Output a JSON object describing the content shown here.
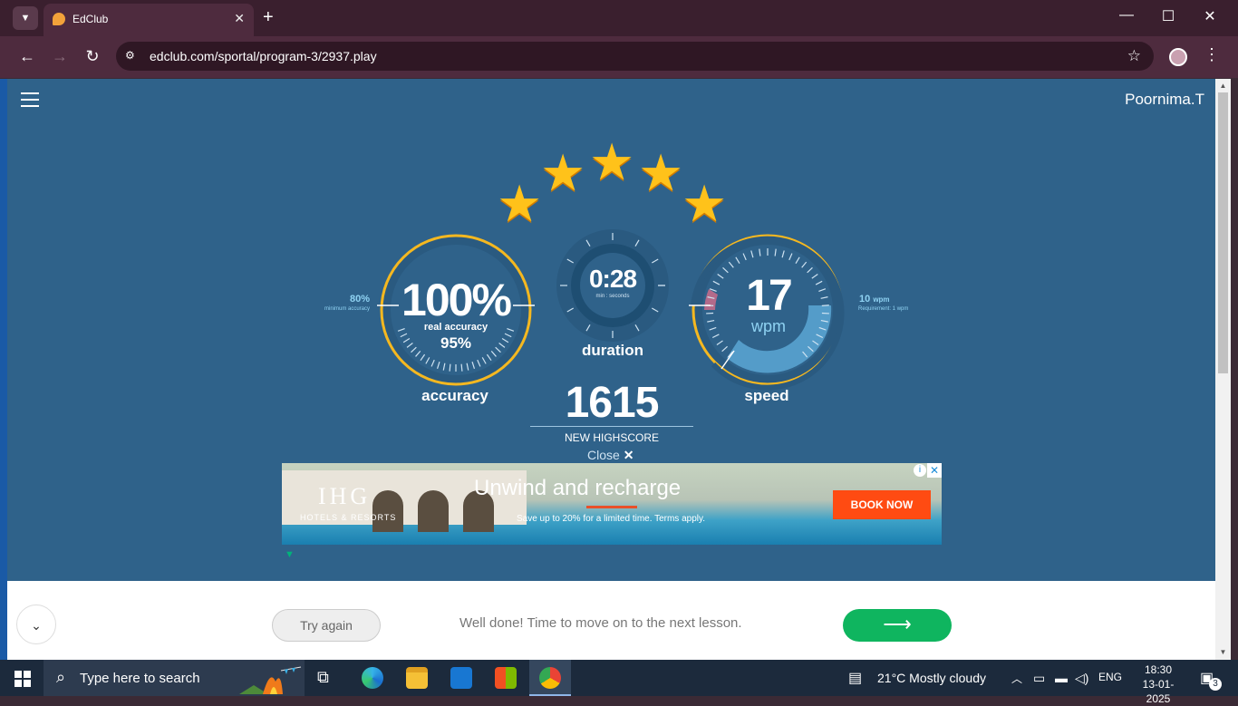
{
  "browser": {
    "tab_title": "EdClub",
    "url": "edclub.com/sportal/program-3/2937.play",
    "tab_close": "✕",
    "new_tab": "+"
  },
  "page": {
    "user_name": "Poornima.T",
    "accuracy": {
      "value": "100%",
      "real_label": "real accuracy",
      "real_value": "95%",
      "label": "accuracy",
      "min_value": "80%",
      "min_label": "minimum accuracy"
    },
    "duration": {
      "value": "0:28",
      "unit": "min : seconds",
      "label": "duration"
    },
    "speed": {
      "value": "17",
      "unit": "wpm",
      "label": "speed",
      "req_value": "10",
      "req_unit": "wpm",
      "req_label": "Requirement: 1 wpm"
    },
    "score": {
      "value": "1615",
      "label": "NEW HIGHSCORE"
    },
    "close_label": "Close",
    "stars_earned": 5
  },
  "ad": {
    "logo": "IHG",
    "logo_sub": "HOTELS & RESORTS",
    "headline": "Unwind and recharge",
    "body": "Save up to 20% for a limited time. Terms apply.",
    "cta": "BOOK NOW"
  },
  "footer": {
    "try_again": "Try again",
    "message": "Well done! Time to move on to the next lesson.",
    "next_arrow": "⟶"
  },
  "taskbar": {
    "search_placeholder": "Type here to search",
    "weather": "21°C  Mostly cloudy",
    "language": "ENG",
    "time": "18:30",
    "date": "13-01-2025",
    "notifications": "3"
  },
  "colors": {
    "page_bg": "#2f628a",
    "ring_gold": "#f5b820",
    "accent_green": "#0fb55f",
    "ad_cta": "#ff4b12"
  }
}
